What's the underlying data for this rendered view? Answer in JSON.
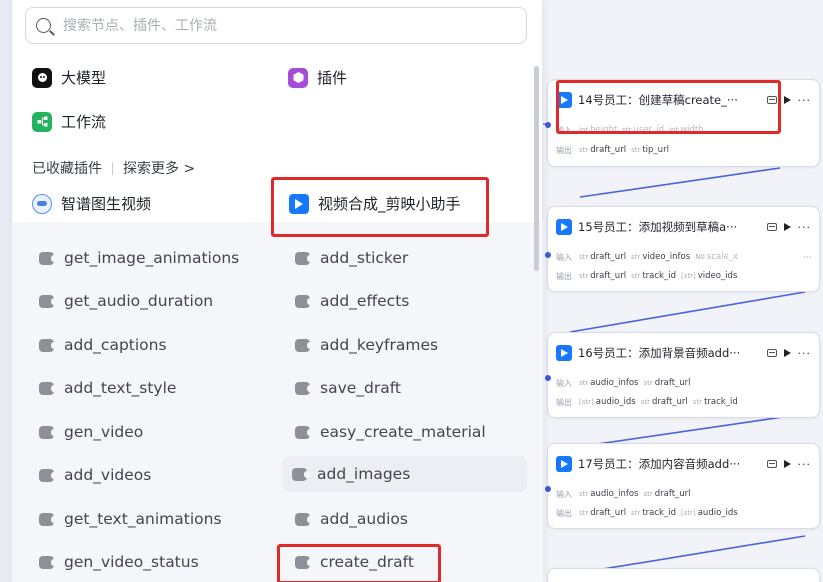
{
  "search": {
    "placeholder": "搜索节点、插件、工作流"
  },
  "categories": {
    "llm": "大模型",
    "plugin": "插件",
    "workflow": "工作流"
  },
  "section": {
    "favorites": "已收藏插件",
    "explore": "探索更多 >"
  },
  "favorite_plugins": [
    "智谱图生视频",
    "视频合成_剪映小助手"
  ],
  "tools_left": [
    "get_image_animations",
    "get_audio_duration",
    "add_captions",
    "add_text_style",
    "gen_video",
    "add_videos",
    "get_text_animations",
    "gen_video_status"
  ],
  "tools_right": [
    "add_sticker",
    "add_effects",
    "add_keyframes",
    "save_draft",
    "easy_create_material",
    "add_images",
    "add_audios",
    "create_draft"
  ],
  "io_labels": {
    "input": "输入",
    "output": "输出"
  },
  "nodes": [
    {
      "title": "14号员工：创建草稿create_···",
      "inputs": [
        {
          "type": "int",
          "name": "height"
        },
        {
          "type": "str",
          "name": "user_id"
        },
        {
          "type": "int",
          "name": "width"
        }
      ],
      "outputs": [
        {
          "type": "str",
          "name": "draft_url"
        },
        {
          "type": "str",
          "name": "tip_url"
        }
      ]
    },
    {
      "title": "15号员工：添加视频到草稿a···",
      "inputs": [
        {
          "type": "str",
          "name": "draft_url"
        },
        {
          "type": "str",
          "name": "video_infos"
        },
        {
          "type": "N0",
          "name": "scale_x"
        }
      ],
      "outputs": [
        {
          "type": "str",
          "name": "draft_url"
        },
        {
          "type": "str",
          "name": "track_id"
        },
        {
          "type": "[str]",
          "name": "video_ids"
        }
      ],
      "more": "···"
    },
    {
      "title": "16号员工：添加背景音频add···",
      "inputs": [
        {
          "type": "str",
          "name": "audio_infos"
        },
        {
          "type": "str",
          "name": "draft_url"
        }
      ],
      "outputs": [
        {
          "type": "[str]",
          "name": "audio_ids"
        },
        {
          "type": "str",
          "name": "draft_url"
        },
        {
          "type": "str",
          "name": "track_id"
        }
      ]
    },
    {
      "title": "17号员工：添加内容音频add···",
      "inputs": [
        {
          "type": "str",
          "name": "audio_infos"
        },
        {
          "type": "str",
          "name": "draft_url"
        }
      ],
      "outputs": [
        {
          "type": "str",
          "name": "draft_url"
        },
        {
          "type": "str",
          "name": "track_id"
        },
        {
          "type": "[str]",
          "name": "audio_ids"
        }
      ]
    }
  ],
  "node_more": "···",
  "colors": {
    "highlight_red": "#e02a2a",
    "jianying_blue": "#1677ff",
    "edge_blue": "#3d5bd6"
  }
}
